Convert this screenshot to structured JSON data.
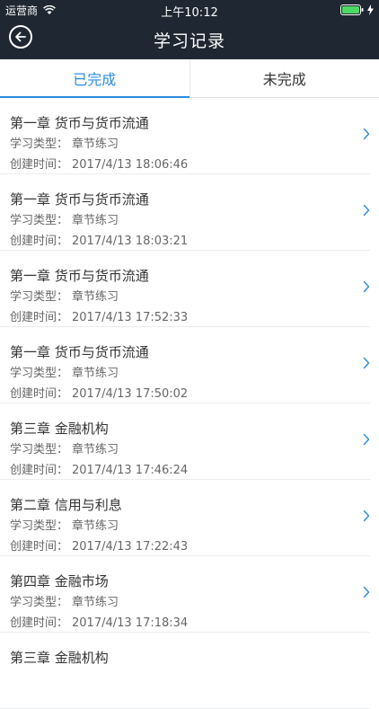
{
  "status_bar": {
    "carrier": "运营商",
    "time": "上午10:12"
  },
  "nav": {
    "title": "学习记录",
    "back_icon": "back-arrow-circle-icon"
  },
  "tabs": [
    {
      "label": "已完成",
      "active": true
    },
    {
      "label": "未完成",
      "active": false
    }
  ],
  "labels": {
    "type_prefix": "学习类型：",
    "created_prefix": "创建时间："
  },
  "records": [
    {
      "title": "第一章 货币与货币流通",
      "type": "章节练习",
      "created": "2017/4/13 18:06:46"
    },
    {
      "title": "第一章 货币与货币流通",
      "type": "章节练习",
      "created": "2017/4/13 18:03:21"
    },
    {
      "title": "第一章 货币与货币流通",
      "type": "章节练习",
      "created": "2017/4/13 17:52:33"
    },
    {
      "title": "第一章 货币与货币流通",
      "type": "章节练习",
      "created": "2017/4/13 17:50:02"
    },
    {
      "title": "第三章 金融机构",
      "type": "章节练习",
      "created": "2017/4/13 17:46:24"
    },
    {
      "title": "第二章 信用与利息",
      "type": "章节练习",
      "created": "2017/4/13 17:22:43"
    },
    {
      "title": "第四章 金融市场",
      "type": "章节练习",
      "created": "2017/4/13 17:18:34"
    },
    {
      "title": "第三章 金融机构",
      "type": "",
      "created": ""
    }
  ],
  "colors": {
    "header_bg": "#1f2732",
    "accent": "#2a8be0"
  }
}
